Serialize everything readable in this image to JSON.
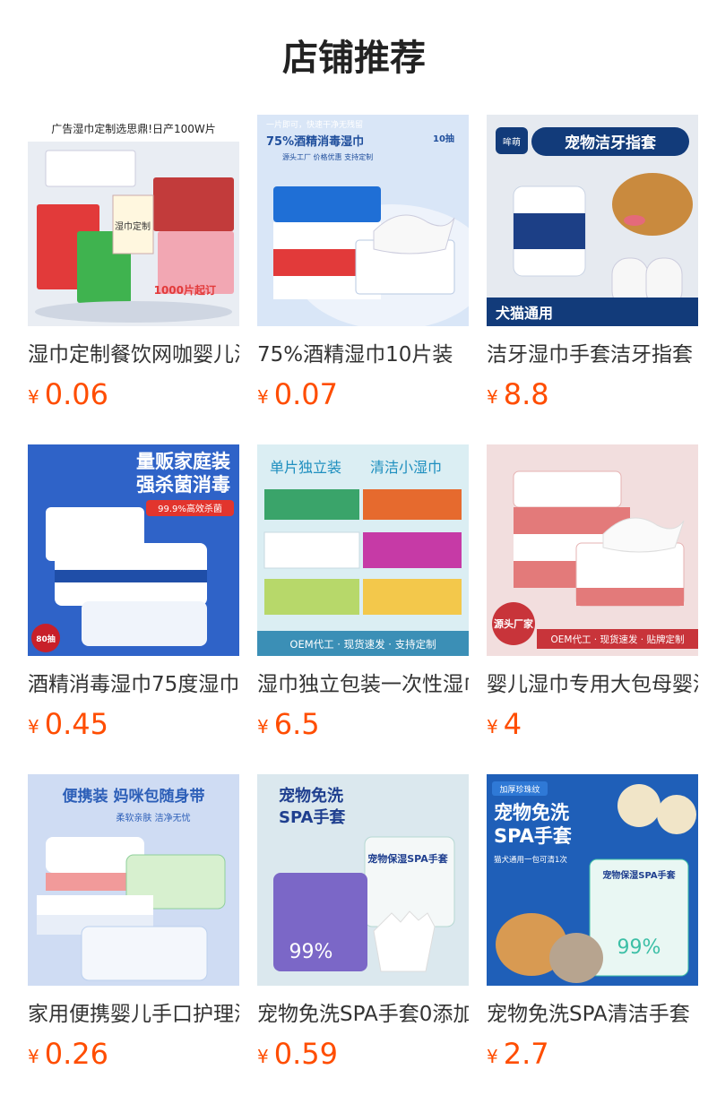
{
  "page": {
    "title": "店铺推荐"
  },
  "currency_symbol": "¥",
  "products": [
    {
      "name": "湿巾定制餐饮网咖婴儿湿巾",
      "price": "0.06",
      "image": {
        "banner": "广告湿巾定制选思鼎!日产100W片",
        "tag": "1000片起订",
        "logo_text": "湿巾定制"
      },
      "colors": {
        "bg": "#e9edf3",
        "accent": "#e23a3a"
      }
    },
    {
      "name": "75%酒精湿巾10片装",
      "price": "0.07",
      "image": {
        "top_line": "一片即可，快速干净无残留",
        "headline": "75%酒精消毒湿巾",
        "sub": "源头工厂 价格优惠 支持定制",
        "count": "10抽"
      },
      "colors": {
        "bg": "#d9e6f7",
        "accent": "#1f6fd6"
      }
    },
    {
      "name": "洁牙湿巾手套洁牙指套",
      "price": "8.8",
      "image": {
        "brand": "哞萌",
        "headline": "宠物洁牙指套",
        "footer": "犬猫通用"
      },
      "colors": {
        "bg": "#e6eaf0",
        "accent": "#123b7a"
      }
    },
    {
      "name": "酒精消毒湿巾75度湿巾",
      "price": "0.45",
      "image": {
        "headline1": "量贩家庭装",
        "headline2": "强杀菌消毒",
        "tag": "99.9%高效杀菌",
        "count": "80抽"
      },
      "colors": {
        "bg": "#2f63c8",
        "accent": "#e2352d"
      }
    },
    {
      "name": "湿巾独立包装一次性湿巾",
      "price": "6.5",
      "image": {
        "top_left": "单片独立装",
        "top_right": "清洁小湿巾",
        "footer": "OEM代工 · 现货速发 · 支持定制"
      },
      "colors": {
        "bg": "#dbeef3",
        "accent": "#1e8fbf"
      }
    },
    {
      "name": "婴儿湿巾专用大包母婴湿巾",
      "price": "4",
      "image": {
        "badge": "源头厂家",
        "footer": "OEM代工 · 现货速发 · 贴牌定制"
      },
      "colors": {
        "bg": "#f2dede",
        "accent": "#c8343a"
      }
    },
    {
      "name": "家用便携婴儿手口护理湿巾",
      "price": "0.26",
      "image": {
        "headline": "便携装 妈咪包随身带",
        "sub": "柔软亲肤 洁净无忧"
      },
      "colors": {
        "bg": "#cfdcf3",
        "accent": "#2d5fb8"
      }
    },
    {
      "name": "宠物免洗SPA手套0添加",
      "price": "0.59",
      "image": {
        "headline1": "宠物免洗",
        "headline2": "SPA手套",
        "pack_text": "宠物保湿SPA手套",
        "percent": "99%"
      },
      "colors": {
        "bg": "#dbe8ee",
        "accent": "#7b67c7"
      }
    },
    {
      "name": "宠物免洗SPA清洁手套",
      "price": "2.7",
      "image": {
        "tag": "加厚珍珠纹",
        "headline1": "宠物免洗",
        "headline2": "SPA手套",
        "sub": "猫犬通用一包可清1次",
        "pack_text": "宠物保湿SPA手套",
        "percent": "99%"
      },
      "colors": {
        "bg": "#1f5fb8",
        "accent": "#3cbfa6"
      }
    }
  ]
}
